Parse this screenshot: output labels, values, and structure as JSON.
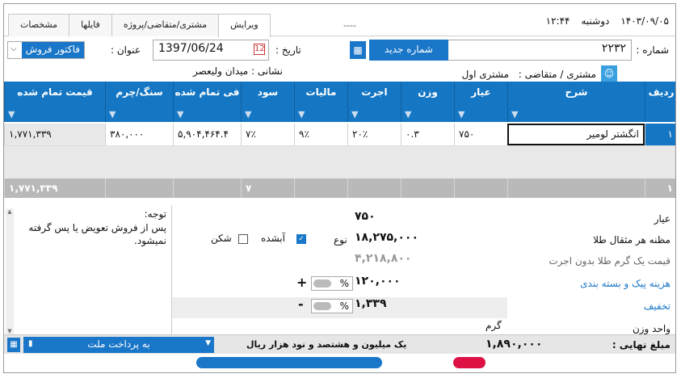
{
  "titlebar": {
    "tabs": [
      "ویرایش",
      "مشتری/متقاضی/پروژه",
      "فایلها",
      "مشخصات"
    ],
    "active_tab": 0,
    "dashes": "----",
    "time": "۱۲:۴۴",
    "weekday": "دوشنبه",
    "date": "۱۴۰۳/۰۹/۰۵"
  },
  "header": {
    "number_label": "شماره :",
    "number_value": "۲۲۳۲",
    "new_number_button": "شماره جدید",
    "date_label": "تاریخ :",
    "date_value": "1397/06/24",
    "title_label": "عنوان :",
    "title_value": "فاکتور فروش",
    "customer_label": "مشتری / متقاضی :",
    "customer_value": "مشتری اول",
    "address_label": "نشانی :",
    "address_value": "میدان ولیعصر"
  },
  "grid": {
    "columns": [
      "ردیف",
      "شرح",
      "عیار",
      "وزن",
      "اجرت",
      "مالیات",
      "سود",
      "فی تمام شده",
      "سنگ/چرم",
      "قیمت تمام شده"
    ],
    "rows": [
      [
        "۱",
        "انگشتر لومیر",
        "۷۵۰",
        "۰.۳",
        "۲۰٪",
        "۹٪",
        "۷٪",
        "۵,۹۰۴,۴۶۴.۴",
        "۳۸۰,۰۰۰",
        "۱,۷۷۱,۳۳۹"
      ]
    ],
    "totals": [
      "۱",
      "",
      "",
      "",
      "",
      "",
      "۷",
      "",
      "",
      "۱,۷۷۱,۳۳۹"
    ]
  },
  "details": {
    "karat_label": "عیار",
    "karat_value": "۷۵۰",
    "price_label": "مظنه هر مثقال طلا",
    "price_value": "۱۸,۲۷۵,۰۰۰",
    "gram_label": "قیمت یک گرم طلا بدون اجرت",
    "gram_value": "۴,۲۱۸,۸۰۰",
    "pack_label": "هزینه پیک و بسته بندی",
    "pack_value": "۱۲۰,۰۰۰",
    "discount_label": "تخفیف",
    "discount_value": "۱,۳۳۹",
    "unit_label": "واحد وزن",
    "unit_value": "گرم",
    "type_label": "نوع",
    "melted_label": "آبشده",
    "broken_label": "شکن",
    "percent": "%",
    "plus": "+",
    "minus": "-"
  },
  "note": {
    "head": "توجه:",
    "body": "پس از فروش تعویض یا پس گرفته نمیشود."
  },
  "footer": {
    "payment": "به پرداخت ملت",
    "total_label": "مبلغ نهایی :",
    "total_value": "۱,۸۹۰,۰۰۰",
    "total_words": "یک میلیون و هشتصد و نود  هزار  ریال"
  },
  "colors": {
    "accent": "#1577c4",
    "header_bg": "#1577c4",
    "total_row": "#b9b9b9"
  }
}
